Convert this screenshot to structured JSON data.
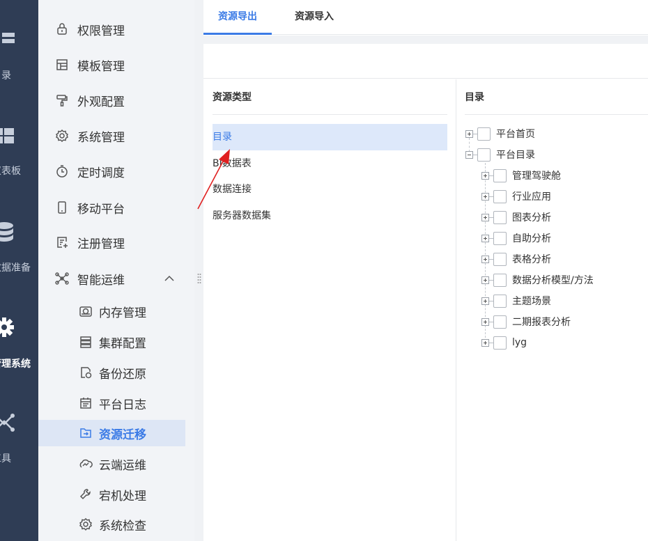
{
  "rail": {
    "items": [
      {
        "label": "目录",
        "icon": "list-icon"
      },
      {
        "label": "仪表板",
        "icon": "dashboard-icon"
      },
      {
        "label": "数据准备",
        "icon": "database-icon"
      },
      {
        "label": "管理系统",
        "icon": "gear-icon"
      },
      {
        "label": "工具",
        "icon": "network-icon"
      }
    ]
  },
  "menu": {
    "items": [
      {
        "label": "权限管理",
        "icon": "lock-icon"
      },
      {
        "label": "模板管理",
        "icon": "template-icon"
      },
      {
        "label": "外观配置",
        "icon": "paint-roller-icon"
      },
      {
        "label": "系统管理",
        "icon": "gear-icon"
      },
      {
        "label": "定时调度",
        "icon": "timer-icon"
      },
      {
        "label": "移动平台",
        "icon": "mobile-icon"
      },
      {
        "label": "注册管理",
        "icon": "register-icon"
      },
      {
        "label": "智能运维",
        "icon": "nodes-icon"
      }
    ],
    "sub_items": [
      {
        "label": "内存管理",
        "icon": "memory-icon"
      },
      {
        "label": "集群配置",
        "icon": "cluster-icon"
      },
      {
        "label": "备份还原",
        "icon": "backup-icon"
      },
      {
        "label": "平台日志",
        "icon": "log-icon"
      },
      {
        "label": "资源迁移",
        "icon": "migrate-icon"
      },
      {
        "label": "云端运维",
        "icon": "cloud-ops-icon"
      },
      {
        "label": "宕机处理",
        "icon": "wrench-icon"
      },
      {
        "label": "系统检查",
        "icon": "gear-check-icon"
      }
    ]
  },
  "tabs": [
    {
      "label": "资源导出"
    },
    {
      "label": "资源导入"
    }
  ],
  "resource_type": {
    "heading": "资源类型",
    "items": [
      "目录",
      "BI数据表",
      "数据连接",
      "服务器数据集"
    ]
  },
  "directory": {
    "heading": "目录",
    "top": [
      {
        "label": "平台首页",
        "expanded": false
      },
      {
        "label": "平台目录",
        "expanded": true
      }
    ],
    "children": [
      "管理驾驶舱",
      "行业应用",
      "图表分析",
      "自助分析",
      "表格分析",
      "数据分析模型/方法",
      "主题场景",
      "二期报表分析",
      "lyg"
    ]
  },
  "colors": {
    "rail_bg": "#2f3d55",
    "accent": "#3b7be6",
    "annotation_arrow": "#e02020"
  }
}
